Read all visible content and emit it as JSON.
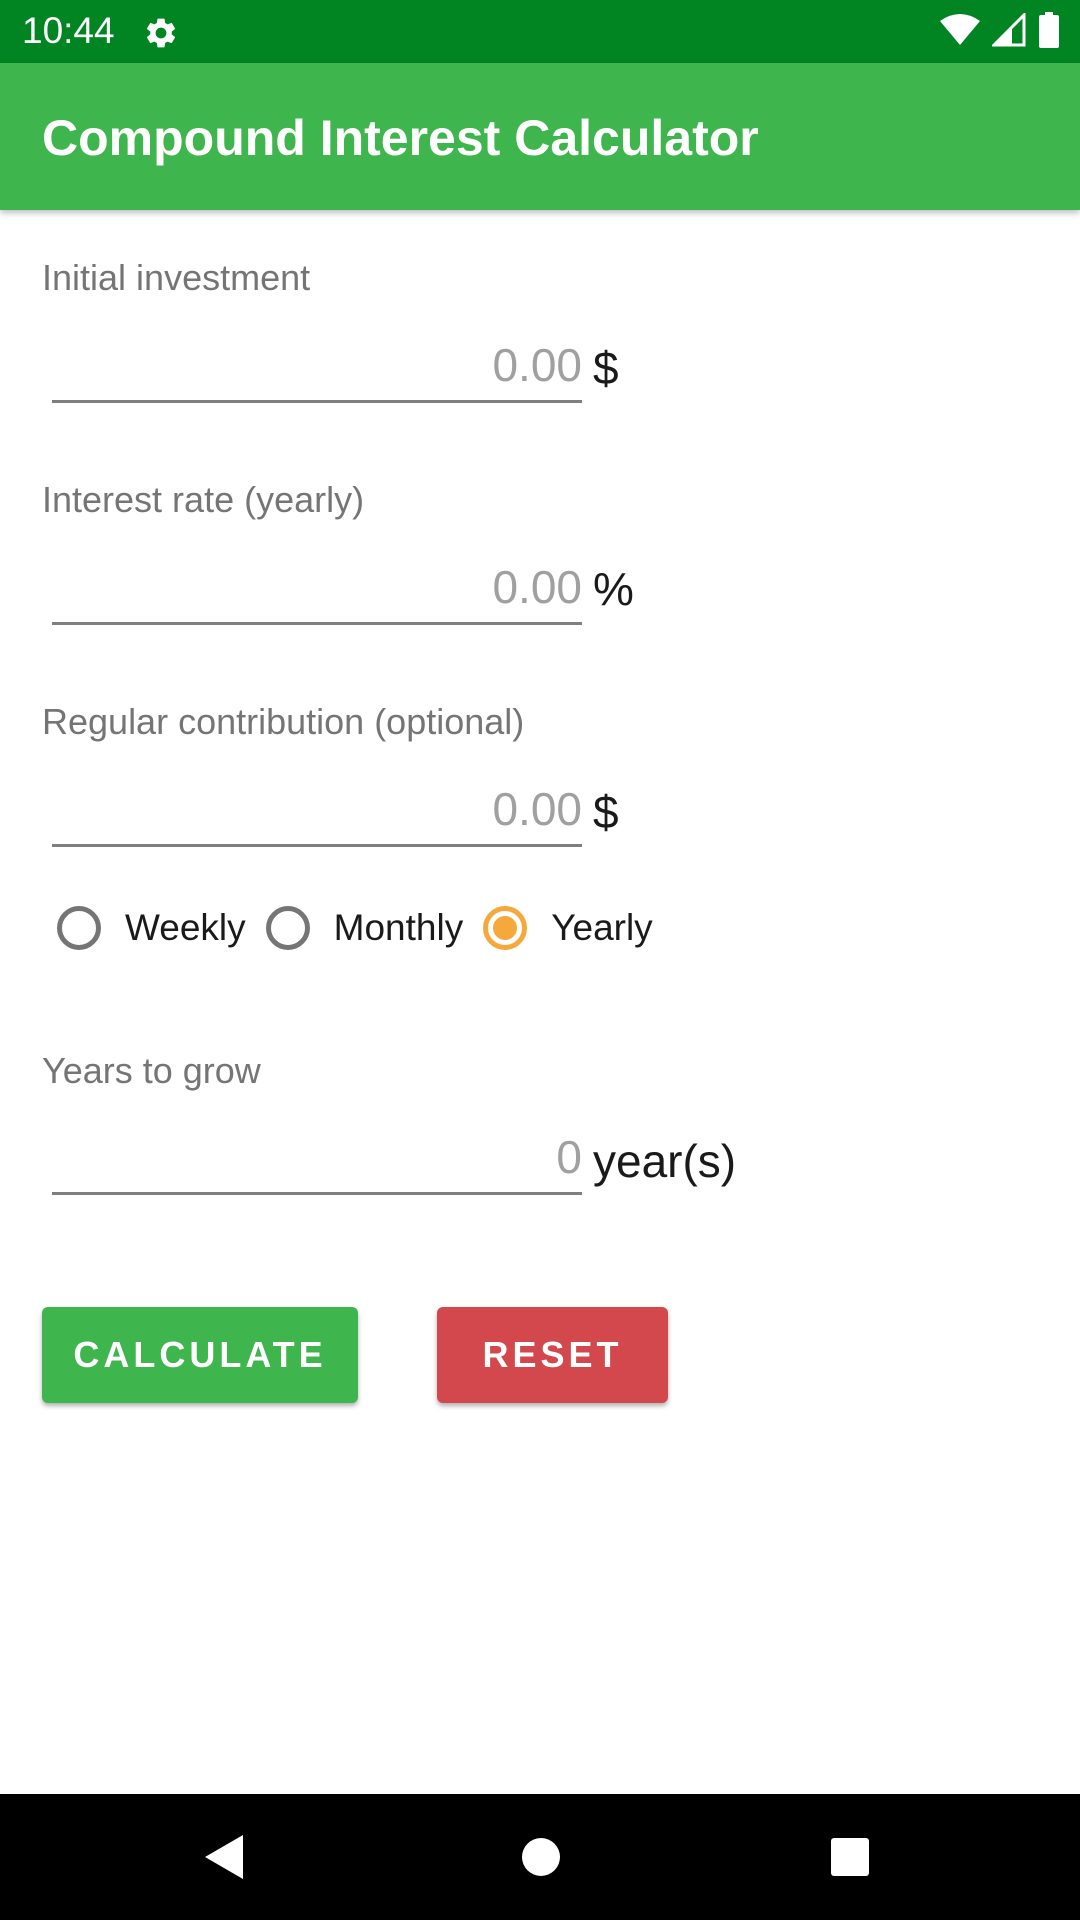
{
  "status_bar": {
    "time": "10:44",
    "icons": [
      "gear-icon",
      "wifi-icon",
      "signal-icon",
      "battery-icon"
    ]
  },
  "app_bar": {
    "title": "Compound Interest Calculator",
    "color": "#3fb54d"
  },
  "form": {
    "initial_investment": {
      "label": "Initial investment",
      "placeholder": "0.00",
      "value": "",
      "unit": "$"
    },
    "interest_rate": {
      "label": "Interest rate (yearly)",
      "placeholder": "0.00",
      "value": "",
      "unit": "%"
    },
    "regular_contribution": {
      "label": "Regular contribution (optional)",
      "placeholder": "0.00",
      "value": "",
      "unit": "$"
    },
    "frequency": {
      "options": [
        "Weekly",
        "Monthly",
        "Yearly"
      ],
      "selected": "Yearly",
      "accent": "#f4a93a"
    },
    "years": {
      "label": "Years to grow",
      "placeholder": "0",
      "value": "",
      "unit": "year(s)"
    }
  },
  "buttons": {
    "calculate": "CALCULATE",
    "reset": "RESET",
    "calculate_color": "#3fb54d",
    "reset_color": "#d2484c"
  },
  "nav_bar": {
    "icons": [
      "back-icon",
      "home-icon",
      "recents-icon"
    ]
  }
}
